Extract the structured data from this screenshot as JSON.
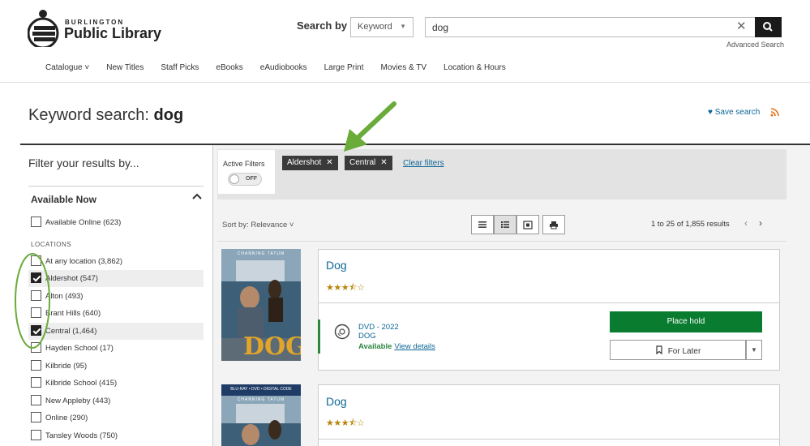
{
  "header": {
    "logo_small": "BURLINGTON",
    "logo_big": "Public Library",
    "search_by_label": "Search by",
    "search_type": "Keyword",
    "search_value": "dog",
    "advanced_search": "Advanced Search"
  },
  "nav": {
    "items": [
      "Catalogue ˅",
      "New Titles",
      "Staff Picks",
      "eBooks",
      "eAudiobooks",
      "Large Print",
      "Movies & TV",
      "Location & Hours"
    ]
  },
  "page": {
    "title_prefix": "Keyword search: ",
    "title_query": "dog",
    "save_search": "♥ Save search"
  },
  "sidebar": {
    "filter_title": "Filter your results by...",
    "section_title": "Available Now",
    "available_online": "Available Online (623)",
    "locations_label": "LOCATIONS",
    "locations": [
      {
        "label": "At any location (3,862)",
        "checked": false
      },
      {
        "label": "Aldershot (547)",
        "checked": true
      },
      {
        "label": "Alton (493)",
        "checked": false
      },
      {
        "label": "Brant Hills (640)",
        "checked": false
      },
      {
        "label": "Central (1,464)",
        "checked": true
      },
      {
        "label": "Hayden School (17)",
        "checked": false
      },
      {
        "label": "Kilbride (95)",
        "checked": false
      },
      {
        "label": "Kilbride School (415)",
        "checked": false
      },
      {
        "label": "New Appleby (443)",
        "checked": false
      },
      {
        "label": "Online (290)",
        "checked": false
      },
      {
        "label": "Tansley Woods (750)",
        "checked": false
      }
    ]
  },
  "filters": {
    "active_label": "Active Filters",
    "toggle_state": "OFF",
    "chips": [
      "Aldershot",
      "Central"
    ],
    "clear": "Clear filters"
  },
  "results_bar": {
    "sort": "Sort by: Relevance ˅",
    "count": "1 to 25 of 1,855 results",
    "prev": "‹",
    "next": "›"
  },
  "results": [
    {
      "title": "Dog",
      "stars": "★★★⯪☆",
      "cover_top": "CHANNING TATUM",
      "cover_word": "DOG",
      "format": "DVD - 2022",
      "subtitle": "DOG",
      "availability": "Available",
      "view_details": "View details",
      "place_hold": "Place hold",
      "for_later": "For Later"
    },
    {
      "title": "Dog",
      "stars": "★★★⯪☆",
      "cover_top": "BLU-RAY • DVD • DIGITAL CODE",
      "cover_sub": "CHANNING TATUM"
    }
  ],
  "colors": {
    "link": "#0e6796",
    "hold_green": "#0a7c2f",
    "annotation_green": "#6aab3a",
    "star": "#b8860b"
  }
}
